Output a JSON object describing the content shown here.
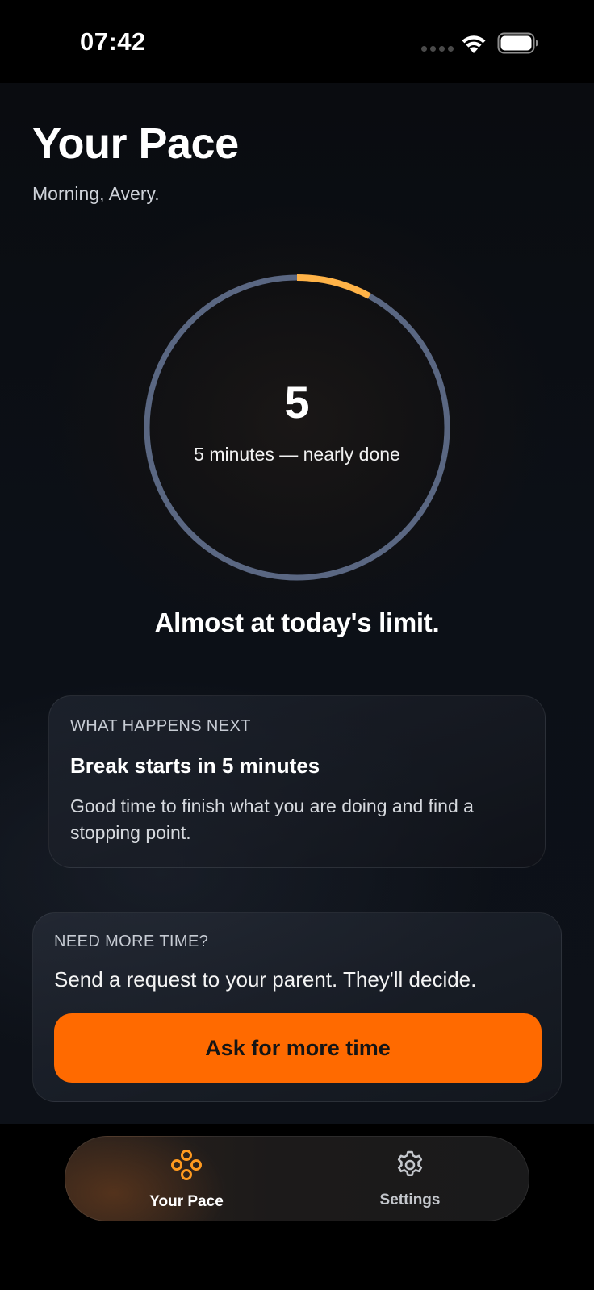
{
  "status_bar": {
    "time": "07:42",
    "icons": [
      "cellular-signal-icon",
      "wifi-icon",
      "battery-icon"
    ]
  },
  "header": {
    "title": "Your Pace",
    "greeting": "Morning, Avery."
  },
  "timer": {
    "minutes_remaining": "5",
    "caption": "5 minutes — nearly done",
    "progress_fraction": 0.08,
    "track_color": "#5a6782",
    "progress_color": "#ffb347"
  },
  "status_message": "Almost at today's limit.",
  "next_card": {
    "eyebrow": "WHAT HAPPENS NEXT",
    "title": "Break starts in 5 minutes",
    "body": "Good time to finish what you are doing and find a stopping point."
  },
  "more_time_card": {
    "eyebrow": "NEED MORE TIME?",
    "body": "Send a request to your parent. They'll decide.",
    "button_label": "Ask for more time",
    "button_color": "#ff6a00"
  },
  "tab_bar": {
    "tabs": [
      {
        "label": "Your Pace",
        "icon": "pace-icon",
        "active": true
      },
      {
        "label": "Settings",
        "icon": "gear-icon",
        "active": false
      }
    ],
    "active_color": "#ff9a1f"
  }
}
